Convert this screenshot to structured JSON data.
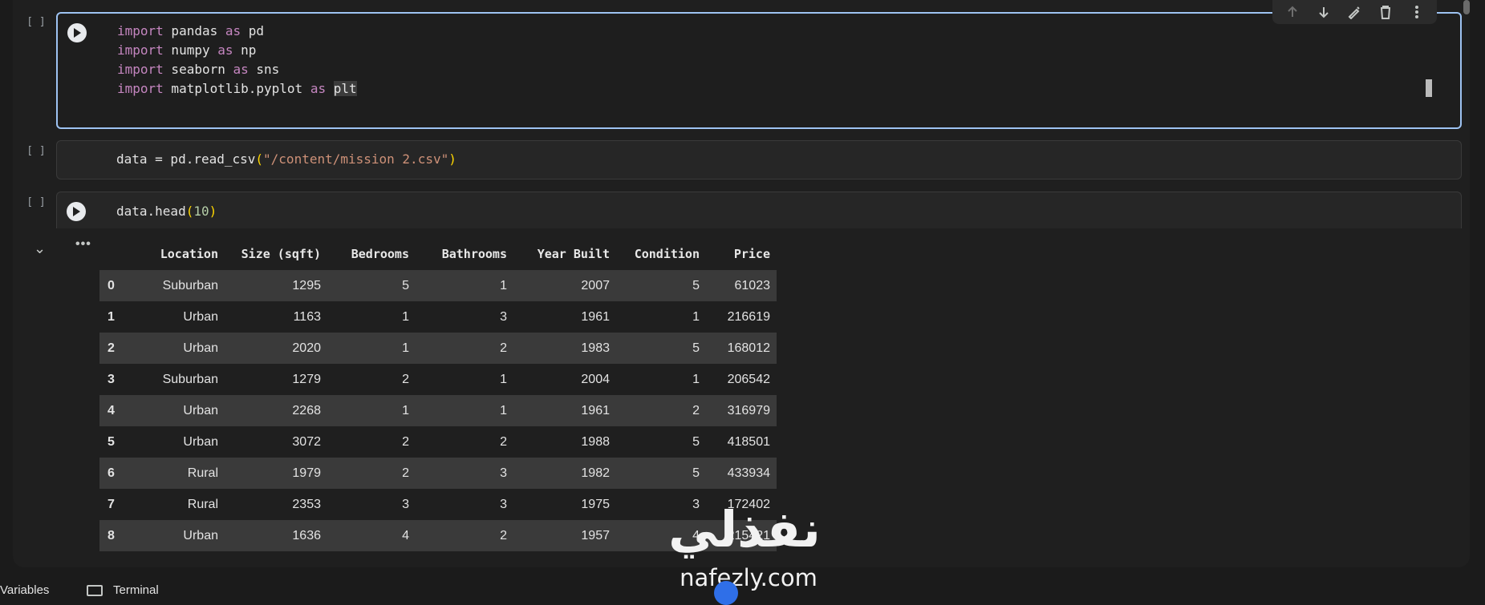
{
  "cells": [
    {
      "exec": "[ ]",
      "lines": [
        "import pandas as pd",
        "import numpy as np",
        "import seaborn as sns",
        "import matplotlib.pyplot as plt"
      ]
    },
    {
      "exec": "[ ]",
      "code": "data = pd.read_csv(\"/content/mission 2.csv\")"
    },
    {
      "exec": "[ ]",
      "code": "data.head(10)"
    }
  ],
  "toolbar": {
    "icons": [
      "arrow-up-icon",
      "arrow-down-icon",
      "edit-icon",
      "delete-icon",
      "more-vert-icon"
    ]
  },
  "dataframe": {
    "columns": [
      "",
      "Location",
      "Size (sqft)",
      "Bedrooms",
      "Bathrooms",
      "Year Built",
      "Condition",
      "Price"
    ],
    "rows": [
      [
        "0",
        "Suburban",
        "1295",
        "5",
        "1",
        "2007",
        "5",
        "61023"
      ],
      [
        "1",
        "Urban",
        "1163",
        "1",
        "3",
        "1961",
        "1",
        "216619"
      ],
      [
        "2",
        "Urban",
        "2020",
        "1",
        "2",
        "1983",
        "5",
        "168012"
      ],
      [
        "3",
        "Suburban",
        "1279",
        "2",
        "1",
        "2004",
        "1",
        "206542"
      ],
      [
        "4",
        "Urban",
        "2268",
        "1",
        "1",
        "1961",
        "2",
        "316979"
      ],
      [
        "5",
        "Urban",
        "3072",
        "2",
        "2",
        "1988",
        "5",
        "418501"
      ],
      [
        "6",
        "Rural",
        "1979",
        "2",
        "3",
        "1982",
        "5",
        "433934"
      ],
      [
        "7",
        "Rural",
        "2353",
        "3",
        "3",
        "1975",
        "3",
        "172402"
      ],
      [
        "8",
        "Urban",
        "1636",
        "4",
        "2",
        "1957",
        "4",
        "215421"
      ]
    ]
  },
  "bottom": {
    "variables": "Variables",
    "terminal": "Terminal"
  },
  "watermark": {
    "arabic": "نفذلي",
    "latin": "nafezly.com"
  },
  "colors": {
    "keyword": "#c586c0",
    "string": "#ce9178",
    "number": "#b5cea8",
    "active_border": "#9ec3f2"
  }
}
